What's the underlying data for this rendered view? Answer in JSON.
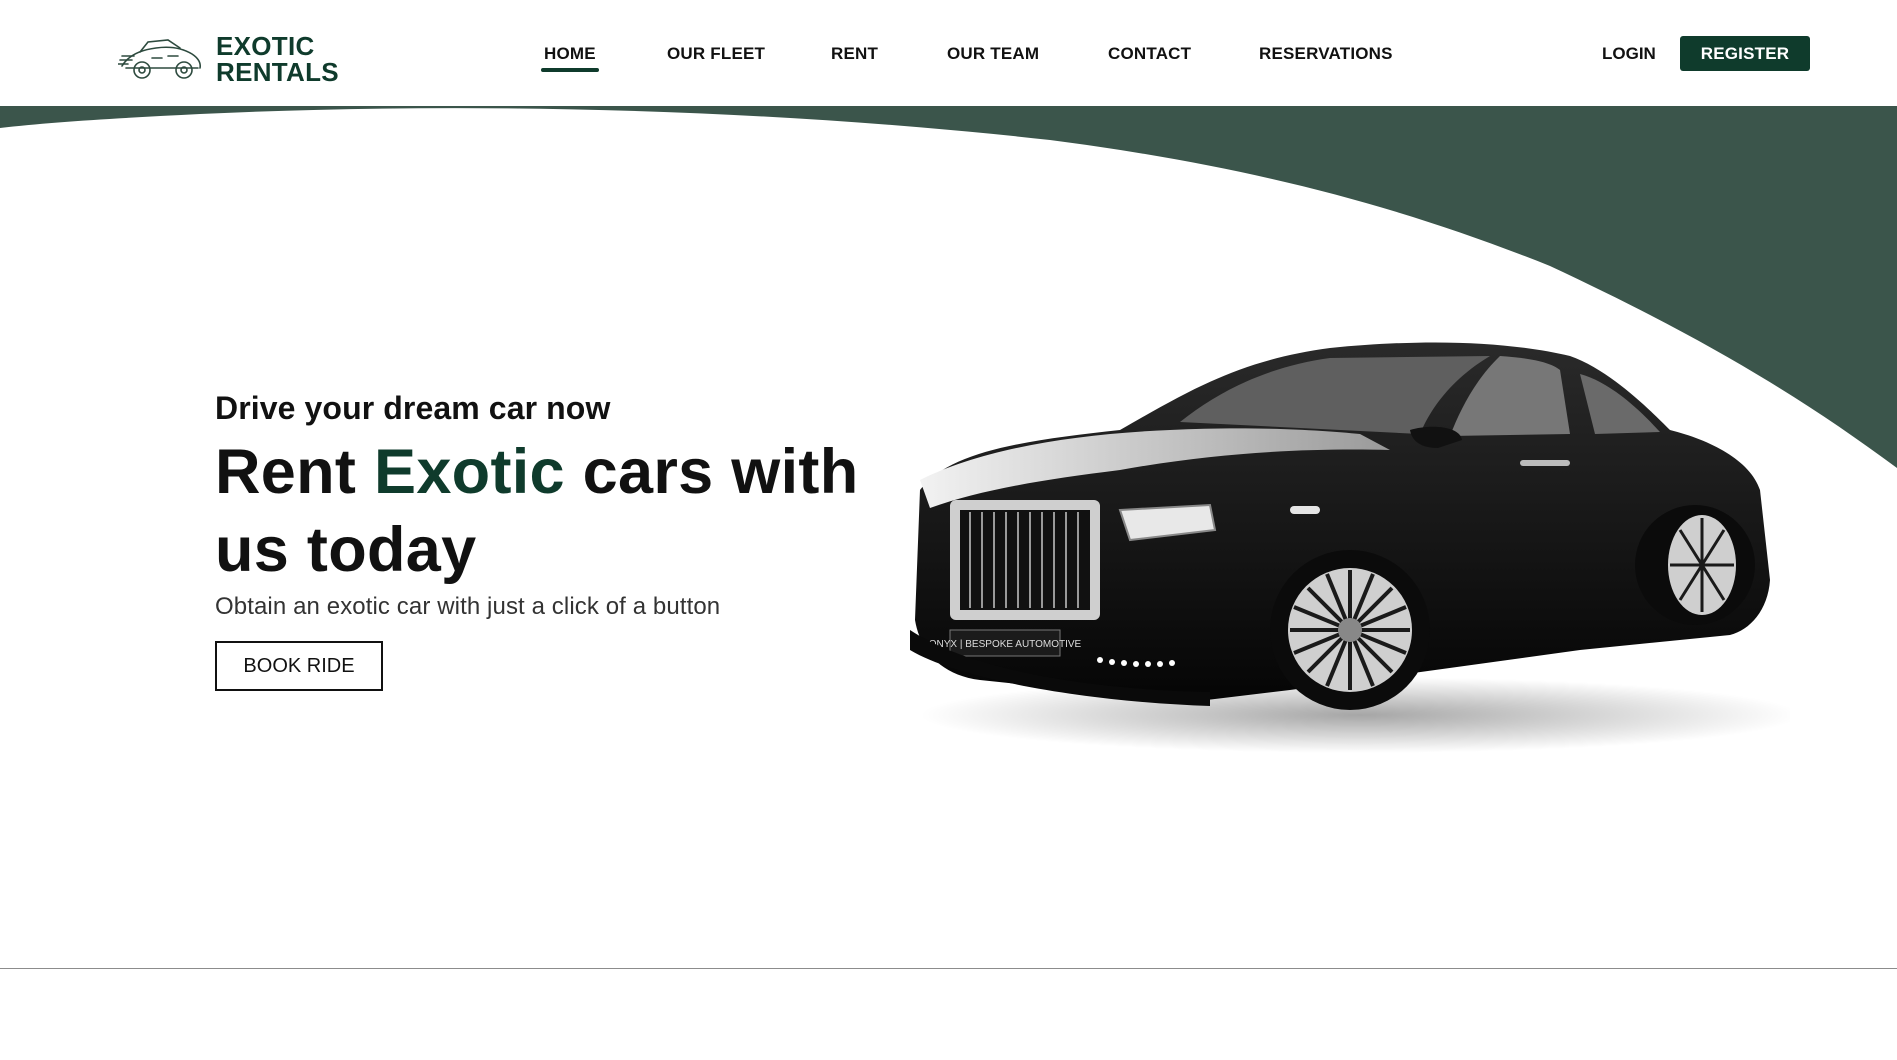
{
  "brand": {
    "line1": "EXOTIC",
    "line2": "RENTALS",
    "logo_icon": "sports-car-logo-icon",
    "color": "#0f3b2c"
  },
  "nav": {
    "items": [
      {
        "label": "HOME",
        "active": true
      },
      {
        "label": "OUR FLEET",
        "active": false
      },
      {
        "label": "RENT",
        "active": false
      },
      {
        "label": "OUR TEAM",
        "active": false
      },
      {
        "label": "CONTACT",
        "active": false
      },
      {
        "label": "RESERVATIONS",
        "active": false
      }
    ]
  },
  "auth": {
    "login_label": "LOGIN",
    "register_label": "REGISTER"
  },
  "hero": {
    "tagline": "Drive your dream car now",
    "headline_part1": "Rent ",
    "headline_accent": "Exotic",
    "headline_part2": " cars with us today",
    "subtext": "Obtain an exotic car with just a click of a button",
    "cta_label": "BOOK RIDE",
    "car_image": "black-luxury-sedan-image",
    "plate_text": "ONYX | BESPOKE AUTOMOTIVE"
  },
  "colors": {
    "primary": "#0f3b2c",
    "wave": "#3b554b",
    "text": "#111111"
  }
}
